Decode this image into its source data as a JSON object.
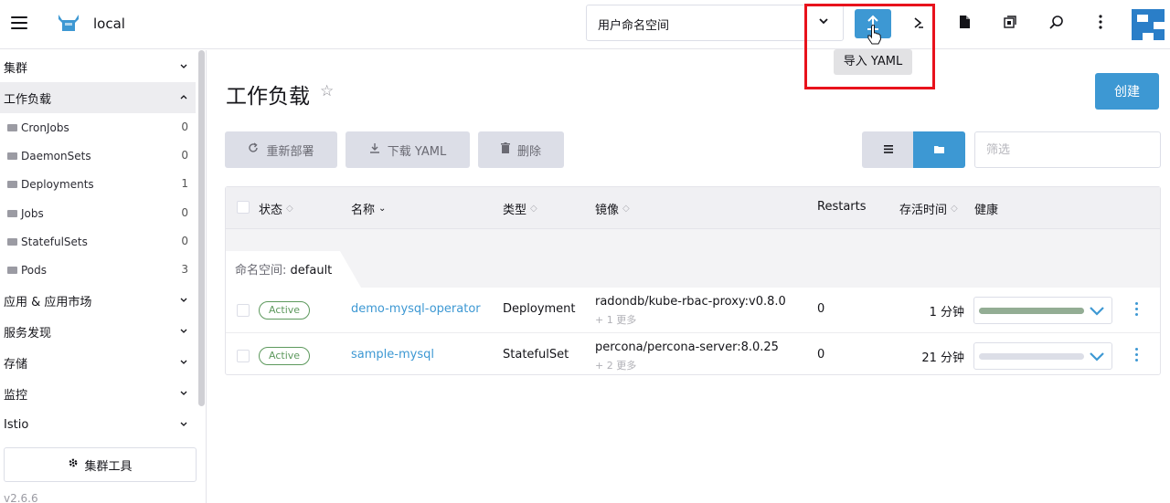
{
  "header": {
    "cluster_name": "local",
    "namespace_select": "用户命名空间",
    "tooltip": "导入 YAML",
    "accent_color": "#3d98d3",
    "highlight_color": "#e8121c"
  },
  "sidebar": {
    "groups": [
      {
        "label": "集群"
      },
      {
        "label": "工作负载"
      },
      {
        "label": "应用 & 应用市场"
      },
      {
        "label": "服务发现"
      },
      {
        "label": "存储"
      },
      {
        "label": "监控"
      },
      {
        "label": "Istio"
      }
    ],
    "items": [
      {
        "label": "CronJobs",
        "count": "0"
      },
      {
        "label": "DaemonSets",
        "count": "0"
      },
      {
        "label": "Deployments",
        "count": "1"
      },
      {
        "label": "Jobs",
        "count": "0"
      },
      {
        "label": "StatefulSets",
        "count": "0"
      },
      {
        "label": "Pods",
        "count": "3"
      }
    ],
    "cluster_tools": "集群工具",
    "version": "v2.6.6"
  },
  "main": {
    "title": "工作负载",
    "create": "创建",
    "actions": {
      "redeploy": "重新部署",
      "download_yaml": "下载 YAML",
      "delete": "删除"
    },
    "filter_placeholder": "筛选",
    "columns": {
      "state": "状态",
      "name": "名称",
      "type": "类型",
      "image": "镜像",
      "restarts": "Restarts",
      "age": "存活时间",
      "health": "健康"
    },
    "group": {
      "label": "命名空间:",
      "value": "default"
    },
    "rows": [
      {
        "state": "Active",
        "name": "demo-mysql-operator",
        "type": "Deployment",
        "image": "radondb/kube-rbac-proxy:v0.8.0",
        "image_more": "+ 1 更多",
        "restarts": "0",
        "age": "1 分钟",
        "health_ready": 1.0
      },
      {
        "state": "Active",
        "name": "sample-mysql",
        "type": "StatefulSet",
        "image": "percona/percona-server:8.0.25",
        "image_more": "+ 2 更多",
        "restarts": "0",
        "age": "21 分钟",
        "health_ready": 0.0
      }
    ]
  }
}
